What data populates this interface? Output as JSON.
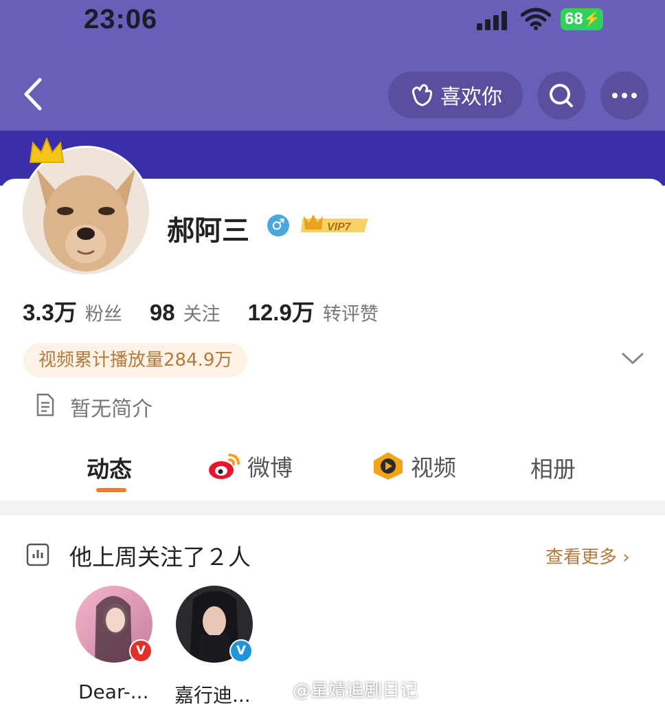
{
  "status_bar": {
    "time": "23:06",
    "battery": "68"
  },
  "nav": {
    "like_label": "喜欢你"
  },
  "profile": {
    "name": "郝阿三",
    "gender_symbol": "♂",
    "vip_label": "VIP7",
    "stats": [
      {
        "value": "3.3万",
        "label": "粉丝"
      },
      {
        "value": "98",
        "label": "关注"
      },
      {
        "value": "12.9万",
        "label": "转评赞"
      }
    ],
    "video_play_count": "视频累计播放量284.9万",
    "bio": "暂无简介"
  },
  "tabs": [
    {
      "label": "动态",
      "icon": "none",
      "active": true
    },
    {
      "label": "微博",
      "icon": "weibo-icon",
      "active": false
    },
    {
      "label": "视频",
      "icon": "video-icon",
      "active": false
    },
    {
      "label": "相册",
      "icon": "none",
      "active": false
    }
  ],
  "followed_section": {
    "title": "他上周关注了２人",
    "see_more": "查看更多",
    "users": [
      {
        "name": "Dear-...",
        "badge": "V",
        "badge_color": "#e0312a"
      },
      {
        "name": "嘉行迪...",
        "badge": "V",
        "badge_color": "#1f95d9"
      }
    ]
  },
  "watermark": "@星婧追剧日记",
  "colors": {
    "header": "#6a5fb8",
    "cover": "#3b2fa9",
    "accent": "#f07c2a",
    "gold": "#b37a3c"
  }
}
